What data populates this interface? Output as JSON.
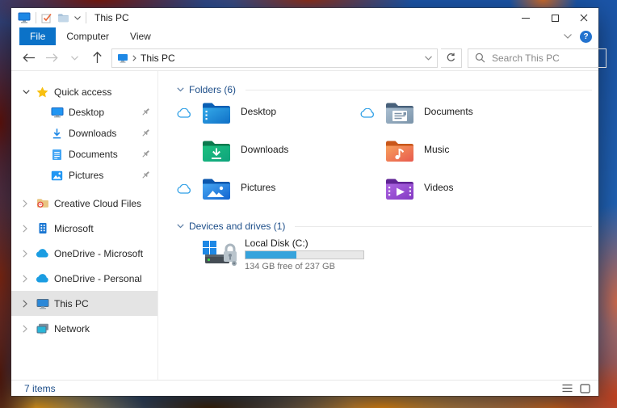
{
  "titlebar": {
    "title": "This PC"
  },
  "ribbon": {
    "tabs": [
      {
        "label": "File",
        "active": true
      },
      {
        "label": "Computer",
        "active": false
      },
      {
        "label": "View",
        "active": false
      }
    ],
    "help_label": "?"
  },
  "toolbar": {
    "breadcrumb": {
      "path": "This PC"
    },
    "search_placeholder": "Search This PC"
  },
  "sidebar": {
    "quick_access": {
      "label": "Quick access",
      "expanded": true,
      "items": [
        {
          "label": "Desktop",
          "icon": "desktop-icon",
          "pinned": true
        },
        {
          "label": "Downloads",
          "icon": "downloads-icon",
          "pinned": true
        },
        {
          "label": "Documents",
          "icon": "documents-icon",
          "pinned": true
        },
        {
          "label": "Pictures",
          "icon": "pictures-icon",
          "pinned": true
        }
      ]
    },
    "roots": [
      {
        "label": "Creative Cloud Files",
        "icon": "creative-cloud-folder-icon",
        "selected": false
      },
      {
        "label": "Microsoft",
        "icon": "microsoft-icon",
        "selected": false
      },
      {
        "label": "OneDrive - Microsoft",
        "icon": "onedrive-cloud-icon",
        "selected": false
      },
      {
        "label": "OneDrive - Personal",
        "icon": "onedrive-cloud-icon",
        "selected": false
      },
      {
        "label": "This PC",
        "icon": "computer-icon",
        "selected": true
      },
      {
        "label": "Network",
        "icon": "network-icon",
        "selected": false
      }
    ]
  },
  "main": {
    "folders_group": {
      "label": "Folders (6)",
      "expanded": true
    },
    "folders": [
      {
        "label": "Desktop",
        "icon": "desktop-folder-icon",
        "cloud_status": true
      },
      {
        "label": "Documents",
        "icon": "documents-folder-icon",
        "cloud_status": true
      },
      {
        "label": "Downloads",
        "icon": "downloads-folder-icon",
        "cloud_status": false
      },
      {
        "label": "Music",
        "icon": "music-folder-icon",
        "cloud_status": false
      },
      {
        "label": "Pictures",
        "icon": "pictures-folder-icon",
        "cloud_status": true
      },
      {
        "label": "Videos",
        "icon": "videos-folder-icon",
        "cloud_status": false
      }
    ],
    "devices_group": {
      "label": "Devices and drives (1)",
      "expanded": true
    },
    "drive": {
      "label": "Local Disk (C:)",
      "capacity_text": "134 GB free of 237 GB",
      "used_percent": 43
    }
  },
  "statusbar": {
    "items_count": "7 items"
  },
  "colors": {
    "accent_blue": "#0b72c8",
    "group_header_text": "#1d4e89",
    "drive_bar_fill": "#36a3dc",
    "selection_gray": "#e4e4e4",
    "onedrive_blue": "#1b9de2"
  }
}
